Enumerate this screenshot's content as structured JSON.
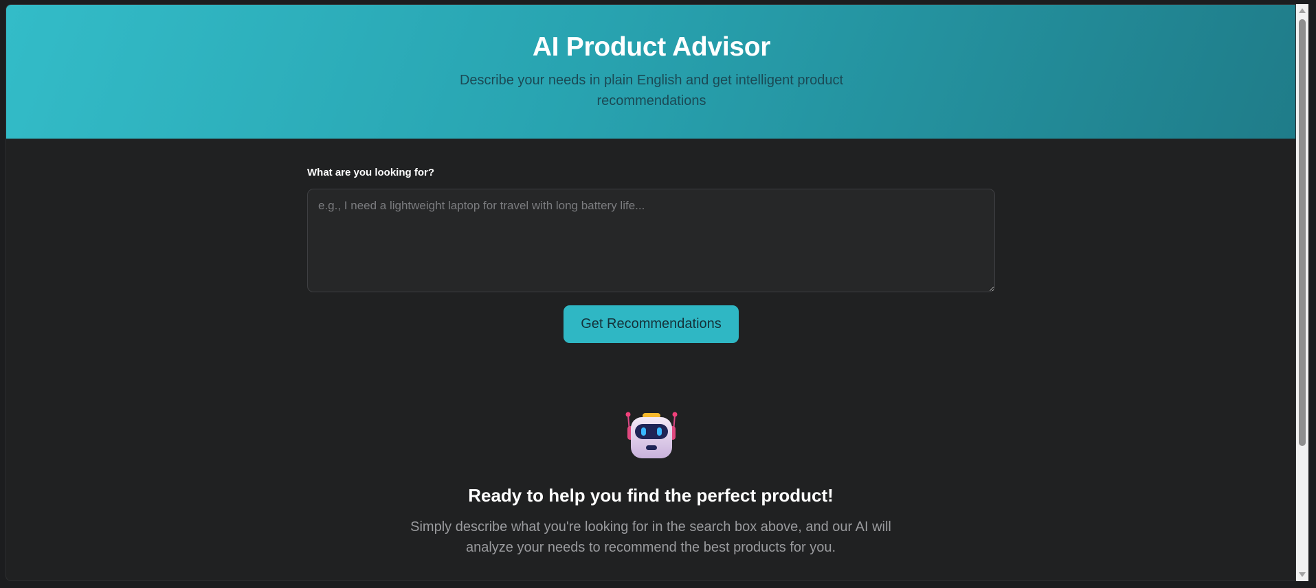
{
  "header": {
    "title": "AI Product Advisor",
    "subtitle": "Describe your needs in plain English and get intelligent product recommendations"
  },
  "search": {
    "label": "What are you looking for?",
    "placeholder": "e.g., I need a lightweight laptop for travel with long battery life...",
    "value": ""
  },
  "actions": {
    "submit_label": "Get Recommendations"
  },
  "empty_state": {
    "icon": "robot-icon",
    "title": "Ready to help you find the perfect product!",
    "text": "Simply describe what you're looking for in the search box above, and our AI will analyze your needs to recommend the best products for you."
  },
  "colors": {
    "accent": "#2fb7c4",
    "background": "#202122",
    "header_gradient_start": "#33bcc8",
    "header_gradient_end": "#1f7c89"
  }
}
